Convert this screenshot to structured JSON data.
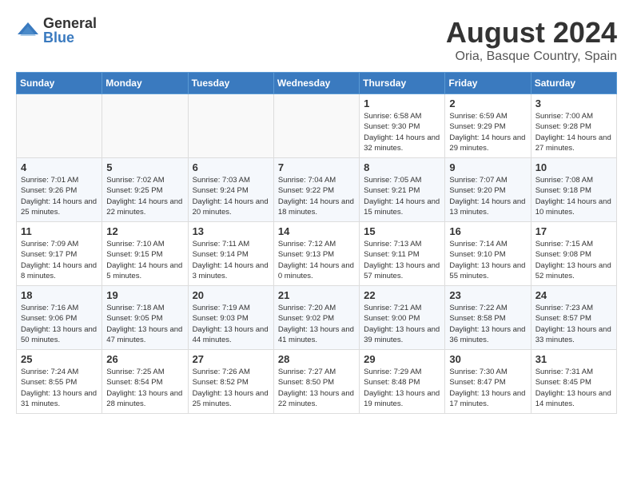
{
  "header": {
    "logo_general": "General",
    "logo_blue": "Blue",
    "month_year": "August 2024",
    "location": "Oria, Basque Country, Spain"
  },
  "days_of_week": [
    "Sunday",
    "Monday",
    "Tuesday",
    "Wednesday",
    "Thursday",
    "Friday",
    "Saturday"
  ],
  "weeks": [
    {
      "days": [
        {
          "num": "",
          "info": ""
        },
        {
          "num": "",
          "info": ""
        },
        {
          "num": "",
          "info": ""
        },
        {
          "num": "",
          "info": ""
        },
        {
          "num": "1",
          "info": "Sunrise: 6:58 AM\nSunset: 9:30 PM\nDaylight: 14 hours\nand 32 minutes."
        },
        {
          "num": "2",
          "info": "Sunrise: 6:59 AM\nSunset: 9:29 PM\nDaylight: 14 hours\nand 29 minutes."
        },
        {
          "num": "3",
          "info": "Sunrise: 7:00 AM\nSunset: 9:28 PM\nDaylight: 14 hours\nand 27 minutes."
        }
      ]
    },
    {
      "days": [
        {
          "num": "4",
          "info": "Sunrise: 7:01 AM\nSunset: 9:26 PM\nDaylight: 14 hours\nand 25 minutes."
        },
        {
          "num": "5",
          "info": "Sunrise: 7:02 AM\nSunset: 9:25 PM\nDaylight: 14 hours\nand 22 minutes."
        },
        {
          "num": "6",
          "info": "Sunrise: 7:03 AM\nSunset: 9:24 PM\nDaylight: 14 hours\nand 20 minutes."
        },
        {
          "num": "7",
          "info": "Sunrise: 7:04 AM\nSunset: 9:22 PM\nDaylight: 14 hours\nand 18 minutes."
        },
        {
          "num": "8",
          "info": "Sunrise: 7:05 AM\nSunset: 9:21 PM\nDaylight: 14 hours\nand 15 minutes."
        },
        {
          "num": "9",
          "info": "Sunrise: 7:07 AM\nSunset: 9:20 PM\nDaylight: 14 hours\nand 13 minutes."
        },
        {
          "num": "10",
          "info": "Sunrise: 7:08 AM\nSunset: 9:18 PM\nDaylight: 14 hours\nand 10 minutes."
        }
      ]
    },
    {
      "days": [
        {
          "num": "11",
          "info": "Sunrise: 7:09 AM\nSunset: 9:17 PM\nDaylight: 14 hours\nand 8 minutes."
        },
        {
          "num": "12",
          "info": "Sunrise: 7:10 AM\nSunset: 9:15 PM\nDaylight: 14 hours\nand 5 minutes."
        },
        {
          "num": "13",
          "info": "Sunrise: 7:11 AM\nSunset: 9:14 PM\nDaylight: 14 hours\nand 3 minutes."
        },
        {
          "num": "14",
          "info": "Sunrise: 7:12 AM\nSunset: 9:13 PM\nDaylight: 14 hours\nand 0 minutes."
        },
        {
          "num": "15",
          "info": "Sunrise: 7:13 AM\nSunset: 9:11 PM\nDaylight: 13 hours\nand 57 minutes."
        },
        {
          "num": "16",
          "info": "Sunrise: 7:14 AM\nSunset: 9:10 PM\nDaylight: 13 hours\nand 55 minutes."
        },
        {
          "num": "17",
          "info": "Sunrise: 7:15 AM\nSunset: 9:08 PM\nDaylight: 13 hours\nand 52 minutes."
        }
      ]
    },
    {
      "days": [
        {
          "num": "18",
          "info": "Sunrise: 7:16 AM\nSunset: 9:06 PM\nDaylight: 13 hours\nand 50 minutes."
        },
        {
          "num": "19",
          "info": "Sunrise: 7:18 AM\nSunset: 9:05 PM\nDaylight: 13 hours\nand 47 minutes."
        },
        {
          "num": "20",
          "info": "Sunrise: 7:19 AM\nSunset: 9:03 PM\nDaylight: 13 hours\nand 44 minutes."
        },
        {
          "num": "21",
          "info": "Sunrise: 7:20 AM\nSunset: 9:02 PM\nDaylight: 13 hours\nand 41 minutes."
        },
        {
          "num": "22",
          "info": "Sunrise: 7:21 AM\nSunset: 9:00 PM\nDaylight: 13 hours\nand 39 minutes."
        },
        {
          "num": "23",
          "info": "Sunrise: 7:22 AM\nSunset: 8:58 PM\nDaylight: 13 hours\nand 36 minutes."
        },
        {
          "num": "24",
          "info": "Sunrise: 7:23 AM\nSunset: 8:57 PM\nDaylight: 13 hours\nand 33 minutes."
        }
      ]
    },
    {
      "days": [
        {
          "num": "25",
          "info": "Sunrise: 7:24 AM\nSunset: 8:55 PM\nDaylight: 13 hours\nand 31 minutes."
        },
        {
          "num": "26",
          "info": "Sunrise: 7:25 AM\nSunset: 8:54 PM\nDaylight: 13 hours\nand 28 minutes."
        },
        {
          "num": "27",
          "info": "Sunrise: 7:26 AM\nSunset: 8:52 PM\nDaylight: 13 hours\nand 25 minutes."
        },
        {
          "num": "28",
          "info": "Sunrise: 7:27 AM\nSunset: 8:50 PM\nDaylight: 13 hours\nand 22 minutes."
        },
        {
          "num": "29",
          "info": "Sunrise: 7:29 AM\nSunset: 8:48 PM\nDaylight: 13 hours\nand 19 minutes."
        },
        {
          "num": "30",
          "info": "Sunrise: 7:30 AM\nSunset: 8:47 PM\nDaylight: 13 hours\nand 17 minutes."
        },
        {
          "num": "31",
          "info": "Sunrise: 7:31 AM\nSunset: 8:45 PM\nDaylight: 13 hours\nand 14 minutes."
        }
      ]
    }
  ]
}
